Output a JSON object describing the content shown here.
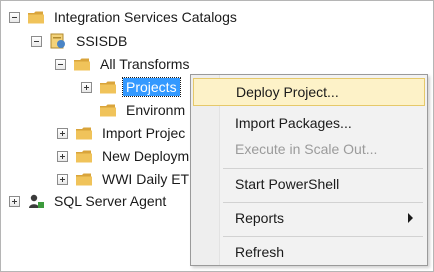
{
  "tree": {
    "catalogs": "Integration Services Catalogs",
    "ssisdb": "SSISDB",
    "all_transforms": "All Transforms",
    "projects": "Projects",
    "environments": "Environm",
    "import_projects": "Import Projec",
    "new_deployment": "New Deploym",
    "wwi_daily": "WWI Daily ET",
    "sql_agent": "SQL Server Agent"
  },
  "context_menu": {
    "deploy_project": "Deploy Project...",
    "import_packages": "Import Packages...",
    "execute_scale_out": "Execute in Scale Out...",
    "start_powershell": "Start PowerShell",
    "reports": "Reports",
    "refresh": "Refresh"
  },
  "colors": {
    "selection": "#3399ff",
    "menu_highlight": "#fdf2c8",
    "folder": "#e8b64a"
  },
  "icons": {
    "folder": "folder-icon",
    "database": "database-icon",
    "agent": "sql-agent-icon",
    "submenu": "submenu-arrow-icon"
  }
}
